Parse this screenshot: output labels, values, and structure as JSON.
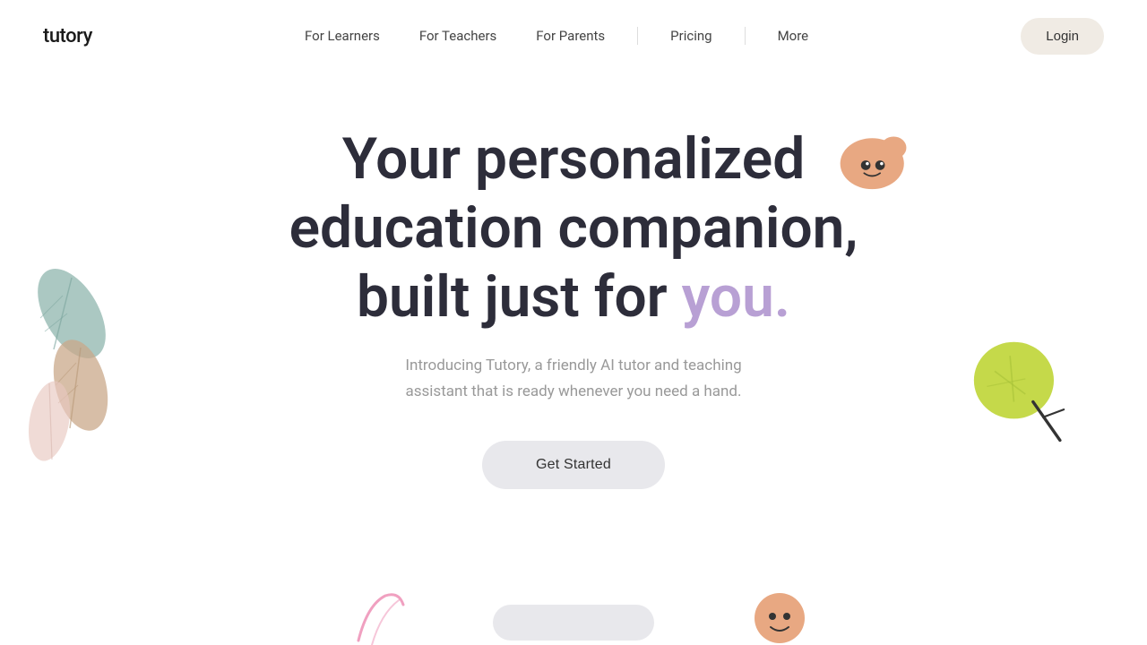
{
  "nav": {
    "logo": "tutory",
    "links": [
      {
        "label": "For Learners",
        "id": "for-learners"
      },
      {
        "label": "For Teachers",
        "id": "for-teachers"
      },
      {
        "label": "For Parents",
        "id": "for-parents"
      },
      {
        "label": "Pricing",
        "id": "pricing"
      },
      {
        "label": "More",
        "id": "more"
      }
    ],
    "login_label": "Login"
  },
  "hero": {
    "title_part1": "Your personalized",
    "title_part2": "education companion,",
    "title_part3": "built just for ",
    "title_highlight": "you.",
    "subtitle": "Introducing Tutory, a friendly AI tutor and teaching assistant that is ready whenever you need a hand.",
    "cta_label": "Get Started"
  },
  "colors": {
    "accent_purple": "#b8a0d4",
    "login_bg": "#f0ebe4",
    "leaf_teal": "#8fb5ae",
    "leaf_brown": "#c9a88a",
    "leaf_pink": "#e8c8c0",
    "tree_green": "#c5d94a",
    "mascot_peach": "#e8a882"
  }
}
